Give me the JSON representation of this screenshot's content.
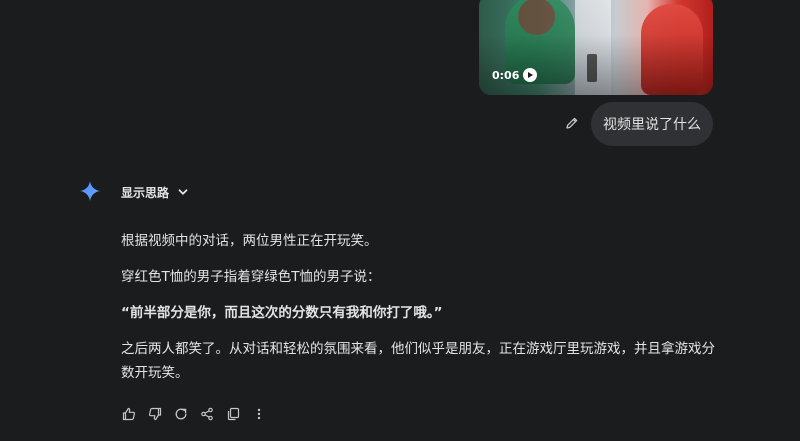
{
  "video": {
    "duration": "0:06"
  },
  "user_message": {
    "text": "视频里说了什么"
  },
  "model": {
    "thinking_toggle_label": "显示思路",
    "paragraphs": [
      "根据视频中的对话，两位男性正在开玩笑。",
      "穿红色T恤的男子指着穿绿色T恤的男子说：",
      "“前半部分是你，而且这次的分数只有我和你打了哦。”",
      "之后两人都笑了。从对话和轻松的氛围来看，他们似乎是朋友，正在游戏厅里玩游戏，并且拿游戏分数开玩笑。"
    ]
  },
  "icons": {
    "edit": "pencil-icon",
    "sparkle": "gemini-sparkle-icon",
    "chevron": "chevron-down-icon",
    "play": "play-icon",
    "actions": [
      "thumbs-up-icon",
      "thumbs-down-icon",
      "regenerate-icon",
      "share-icon",
      "copy-icon",
      "more-vert-icon"
    ]
  },
  "colors": {
    "background": "#1b1c1d",
    "bubble": "#303134",
    "text": "#e3e3e3",
    "sparkle_blue": "#4a8cf7"
  }
}
